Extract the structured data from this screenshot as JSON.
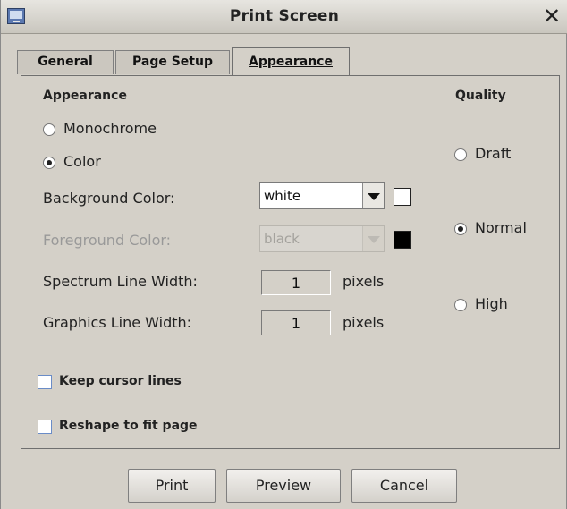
{
  "window": {
    "title": "Print Screen",
    "close_label": "✕"
  },
  "tabs": [
    {
      "label": "General"
    },
    {
      "label": "Page Setup"
    },
    {
      "label": "Appearance",
      "selected": true
    }
  ],
  "appearance": {
    "heading": "Appearance",
    "monochrome_label": "Monochrome",
    "color_label": "Color",
    "selected_mode": "Color",
    "background_label": "Background Color:",
    "background_value": "white",
    "background_swatch": "#ffffff",
    "foreground_label": "Foreground Color:",
    "foreground_value": "black",
    "foreground_swatch": "#000000",
    "spectrum_label": "Spectrum Line Width:",
    "spectrum_value": "1",
    "spectrum_unit": "pixels",
    "graphics_label": "Graphics Line Width:",
    "graphics_value": "1",
    "graphics_unit": "pixels",
    "keep_cursor_label": "Keep cursor lines",
    "keep_cursor_checked": false,
    "reshape_label": "Reshape to fit page",
    "reshape_checked": false
  },
  "quality": {
    "heading": "Quality",
    "draft_label": "Draft",
    "normal_label": "Normal",
    "high_label": "High",
    "selected": "Normal"
  },
  "buttons": {
    "print": "Print",
    "preview": "Preview",
    "cancel": "Cancel"
  },
  "colors": {
    "dialog_bg": "#d4d0c8",
    "checkbox_border": "#6a8cc7"
  }
}
